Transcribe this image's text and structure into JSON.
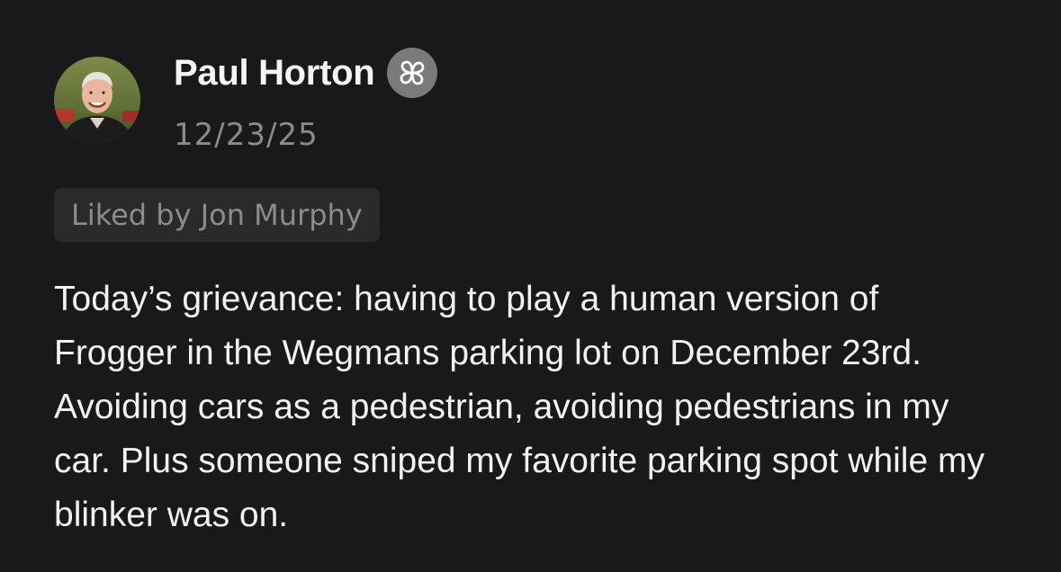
{
  "post": {
    "author": "Paul Horton",
    "badge_icon": "flower-badge-icon",
    "date": "12/23/25",
    "liked_by": "Liked by Jon Murphy",
    "body": "Today’s grievance: having to play a human version of Frogger in the Wegmans parking lot on December 23rd. Avoiding cars as a pedestrian, avoiding pedestrians in my car. Plus someone sniped my favorite parking spot while my blinker was on."
  },
  "colors": {
    "background": "#19191b",
    "text_primary": "#f2f2f2",
    "text_secondary": "#8b8b8e",
    "chip_background": "#2a2a2c",
    "badge_background": "#7a7a7c"
  }
}
